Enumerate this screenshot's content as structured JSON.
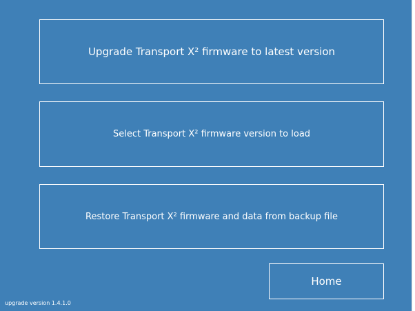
{
  "buttons": {
    "upgrade_latest": "Upgrade Transport X² firmware to latest version",
    "select_version": "Select Transport X² firmware version to load",
    "restore_backup": "Restore Transport X² firmware and data from backup file",
    "home": "Home"
  },
  "footer": {
    "version_text": "upgrade version 1.4.1.0"
  },
  "colors": {
    "background": "#3f80b7",
    "button_border": "#ffffff",
    "text": "#ffffff"
  }
}
